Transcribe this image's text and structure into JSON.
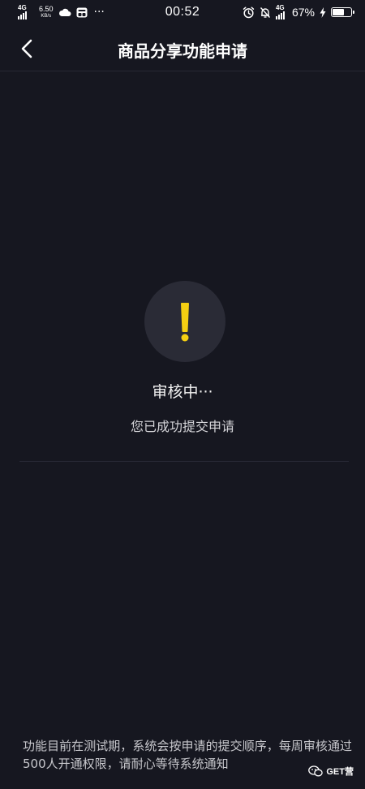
{
  "status_bar": {
    "network": "4G",
    "speed_value": "6.50",
    "speed_unit": "KB/s",
    "more_dots": "···",
    "time": "00:52",
    "network_right": "4G",
    "battery_percent": "67%",
    "battery_level": 0.67
  },
  "header": {
    "title": "商品分享功能申请"
  },
  "review": {
    "title": "审核中···",
    "subtitle": "您已成功提交申请"
  },
  "footer": {
    "note": "功能目前在测试期，系统会按申请的提交顺序，每周审核通过500人开通权限，请耐心等待系统通知"
  },
  "watermark": {
    "text": "GET营"
  },
  "colors": {
    "background": "#161720",
    "accent_yellow": "#f5cf12",
    "circle": "#2a2b36"
  }
}
